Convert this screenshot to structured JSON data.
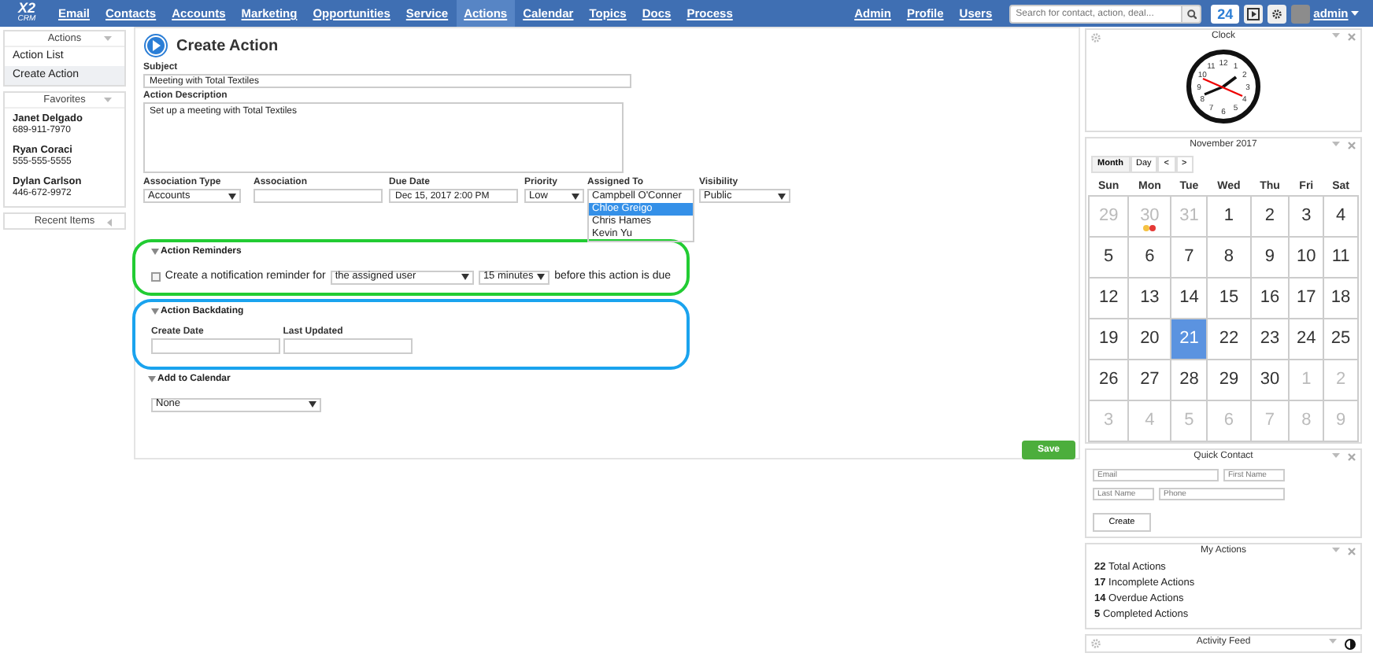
{
  "nav": {
    "logo": "X2",
    "logo_sub": "CRM",
    "items": [
      {
        "label": "Email",
        "selected": false
      },
      {
        "label": "Contacts",
        "selected": false
      },
      {
        "label": "Accounts",
        "selected": false
      },
      {
        "label": "Marketing",
        "selected": false
      },
      {
        "label": "Opportunities",
        "selected": false
      },
      {
        "label": "Service",
        "selected": false
      },
      {
        "label": "Actions",
        "selected": true
      },
      {
        "label": "Calendar",
        "selected": false
      },
      {
        "label": "Topics",
        "selected": false
      },
      {
        "label": "Docs",
        "selected": false
      },
      {
        "label": "Process",
        "selected": false
      }
    ],
    "right_items": [
      "Admin",
      "Profile",
      "Users"
    ],
    "search": {
      "placeholder": "Search for contact, action, deal..."
    },
    "notifications": "24",
    "user": "admin"
  },
  "sidebar": {
    "panels": [
      {
        "title": "Actions",
        "kind": "menu",
        "items": [
          {
            "label": "Action List",
            "selected": false
          },
          {
            "label": "Create Action",
            "selected": true
          }
        ]
      },
      {
        "title": "Favorites",
        "kind": "contacts",
        "items": [
          {
            "name": "Janet Delgado",
            "phone": "689-911-7970"
          },
          {
            "name": "Ryan Coraci",
            "phone": "555-555-5555"
          },
          {
            "name": "Dylan Carlson",
            "phone": "446-672-9972"
          }
        ]
      },
      {
        "title": "Recent Items",
        "kind": "collapsed"
      }
    ]
  },
  "form": {
    "title": "Create Action",
    "subject": {
      "label": "Subject",
      "value": "Meeting with Total Textiles"
    },
    "description": {
      "label": "Action Description",
      "value": "Set up a meeting with Total Textiles"
    },
    "fields": [
      {
        "kind": "select",
        "label": "Association Type",
        "value": "Accounts"
      },
      {
        "kind": "input",
        "label": "Association"
      },
      {
        "kind": "input",
        "label": "Due Date",
        "value": "Dec 15, 2017 2:00 PM"
      },
      {
        "kind": "select",
        "label": "Priority",
        "value": "Low"
      },
      {
        "kind": "listbox",
        "label": "Assigned To",
        "options": [
          {
            "label": "Campbell O'Conner",
            "selected": false
          },
          {
            "label": "Chloe Greigo",
            "selected": true
          },
          {
            "label": "Chris Hames",
            "selected": false
          },
          {
            "label": "Kevin Yu",
            "selected": false
          }
        ]
      },
      {
        "kind": "select",
        "label": "Visibility",
        "value": "Public"
      }
    ],
    "reminders": {
      "title": "Action Reminders",
      "checked": false,
      "text_before": "Create a notification reminder for",
      "recipient": "the assigned user",
      "time": "15 minutes",
      "text_after": "before this action is due"
    },
    "backdating": {
      "title": "Action Backdating",
      "fields": [
        {
          "label": "Create Date"
        },
        {
          "label": "Last Updated"
        }
      ]
    },
    "add_to_calendar": {
      "title": "Add to Calendar",
      "value": "None"
    },
    "save": "Save"
  },
  "widgets": {
    "clock": {
      "title": "Clock",
      "numerals": [
        "12",
        "11",
        "1",
        "10",
        "2",
        "9",
        "3",
        "8",
        "4",
        "7",
        "5",
        "6"
      ]
    },
    "calendar": {
      "title": "November 2017",
      "views": [
        {
          "label": "Month",
          "selected": true
        },
        {
          "label": "Day",
          "selected": false
        }
      ],
      "prev": "<",
      "next": ">",
      "weekdays": [
        "Sun",
        "Mon",
        "Tue",
        "Wed",
        "Thu",
        "Fri",
        "Sat"
      ],
      "weeks": [
        [
          {
            "day": "29",
            "muted": true,
            "selected": false
          },
          {
            "day": "30",
            "muted": true,
            "selected": false,
            "dots": [
              {
                "color": "#f5c242"
              },
              {
                "color": "#e53935"
              }
            ]
          },
          {
            "day": "31",
            "muted": true,
            "selected": false
          },
          {
            "day": "1",
            "muted": false,
            "selected": false
          },
          {
            "day": "2",
            "muted": false,
            "selected": false
          },
          {
            "day": "3",
            "muted": false,
            "selected": false
          },
          {
            "day": "4",
            "muted": false,
            "selected": false
          }
        ],
        [
          {
            "day": "5",
            "muted": false,
            "selected": false
          },
          {
            "day": "6",
            "muted": false,
            "selected": false
          },
          {
            "day": "7",
            "muted": false,
            "selected": false
          },
          {
            "day": "8",
            "muted": false,
            "selected": false
          },
          {
            "day": "9",
            "muted": false,
            "selected": false
          },
          {
            "day": "10",
            "muted": false,
            "selected": false
          },
          {
            "day": "11",
            "muted": false,
            "selected": false
          }
        ],
        [
          {
            "day": "12",
            "muted": false,
            "selected": false
          },
          {
            "day": "13",
            "muted": false,
            "selected": false
          },
          {
            "day": "14",
            "muted": false,
            "selected": false
          },
          {
            "day": "15",
            "muted": false,
            "selected": false
          },
          {
            "day": "16",
            "muted": false,
            "selected": false
          },
          {
            "day": "17",
            "muted": false,
            "selected": false
          },
          {
            "day": "18",
            "muted": false,
            "selected": false
          }
        ],
        [
          {
            "day": "19",
            "muted": false,
            "selected": false
          },
          {
            "day": "20",
            "muted": false,
            "selected": false
          },
          {
            "day": "21",
            "muted": false,
            "selected": true
          },
          {
            "day": "22",
            "muted": false,
            "selected": false
          },
          {
            "day": "23",
            "muted": false,
            "selected": false
          },
          {
            "day": "24",
            "muted": false,
            "selected": false
          },
          {
            "day": "25",
            "muted": false,
            "selected": false
          }
        ],
        [
          {
            "day": "26",
            "muted": false,
            "selected": false
          },
          {
            "day": "27",
            "muted": false,
            "selected": false
          },
          {
            "day": "28",
            "muted": false,
            "selected": false
          },
          {
            "day": "29",
            "muted": false,
            "selected": false
          },
          {
            "day": "30",
            "muted": false,
            "selected": false
          },
          {
            "day": "1",
            "muted": true,
            "selected": false
          },
          {
            "day": "2",
            "muted": true,
            "selected": false
          }
        ],
        [
          {
            "day": "3",
            "muted": true,
            "selected": false
          },
          {
            "day": "4",
            "muted": true,
            "selected": false
          },
          {
            "day": "5",
            "muted": true,
            "selected": false
          },
          {
            "day": "6",
            "muted": true,
            "selected": false
          },
          {
            "day": "7",
            "muted": true,
            "selected": false
          },
          {
            "day": "8",
            "muted": true,
            "selected": false
          },
          {
            "day": "9",
            "muted": true,
            "selected": false
          }
        ]
      ]
    },
    "quick_contact": {
      "title": "Quick Contact",
      "fields": [
        {
          "placeholder": "Email"
        },
        {
          "placeholder": "First Name"
        },
        {
          "placeholder": "Last Name"
        },
        {
          "placeholder": "Phone"
        }
      ],
      "button": "Create"
    },
    "my_actions": {
      "title": "My Actions",
      "stats": [
        {
          "count": "22",
          "label": "Total Actions"
        },
        {
          "count": "17",
          "label": "Incomplete Actions"
        },
        {
          "count": "14",
          "label": "Overdue Actions"
        },
        {
          "count": "5",
          "label": "Completed Actions"
        }
      ]
    },
    "activity_feed": {
      "title": "Activity Feed"
    }
  }
}
